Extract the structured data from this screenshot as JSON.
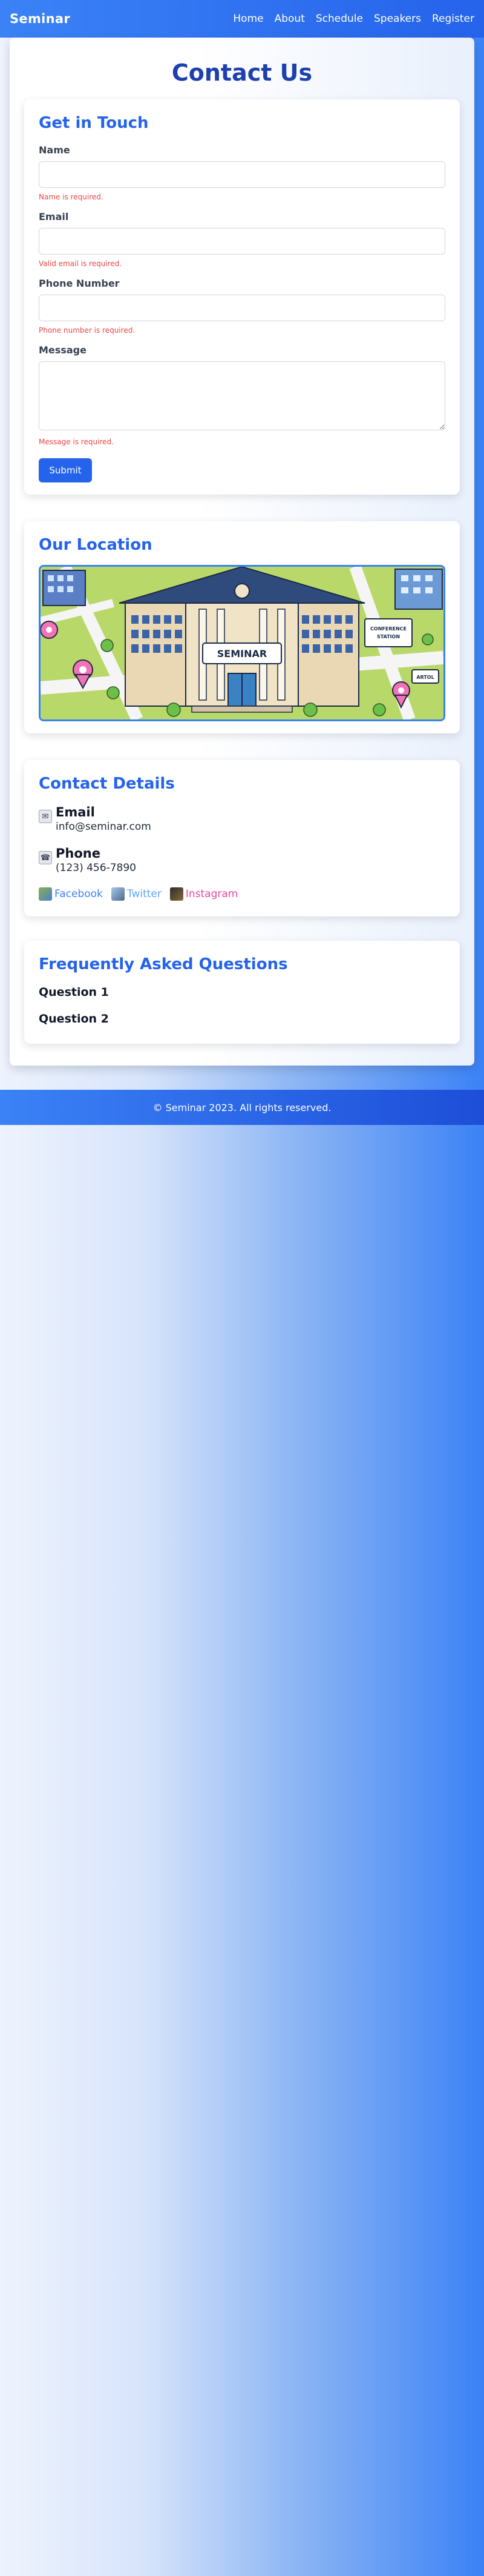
{
  "nav": {
    "brand": "Seminar",
    "links": [
      "Home",
      "About",
      "Schedule",
      "Speakers",
      "Register"
    ]
  },
  "page": {
    "title": "Contact Us"
  },
  "form": {
    "title": "Get in Touch",
    "fields": [
      {
        "label": "Name",
        "value": "",
        "placeholder": "",
        "error": "Name is required."
      },
      {
        "label": "Email",
        "value": "",
        "placeholder": "",
        "error": "Valid email is required."
      },
      {
        "label": "Phone Number",
        "value": "",
        "placeholder": "",
        "error": "Phone number is required."
      },
      {
        "label": "Message",
        "value": "",
        "placeholder": "",
        "error": "Message is required."
      }
    ],
    "submit_label": "Submit"
  },
  "location": {
    "title": "Our Location",
    "map_sign": "SEMINAR",
    "map_sign_left": "CONFERENCE STATION",
    "map_sign_right": "ARTOL"
  },
  "contact": {
    "title": "Contact Details",
    "email_title": "Email",
    "email_value": "info@seminar.com",
    "phone_title": "Phone",
    "phone_value": "(123) 456-7890",
    "socials": [
      {
        "label": "Facebook",
        "color": "#3b82f6",
        "icon": "facebook-icon"
      },
      {
        "label": "Twitter",
        "color": "#60a5fa",
        "icon": "twitter-icon"
      },
      {
        "label": "Instagram",
        "color": "#ec4899",
        "icon": "instagram-icon"
      }
    ]
  },
  "faq": {
    "title": "Frequently Asked Questions",
    "questions": [
      "Question 1",
      "Question 2"
    ]
  },
  "footer": {
    "text": "© Seminar 2023. All rights reserved."
  },
  "colors": {
    "primary": "#2563eb",
    "title": "#1e40af",
    "error": "#ef4444"
  }
}
